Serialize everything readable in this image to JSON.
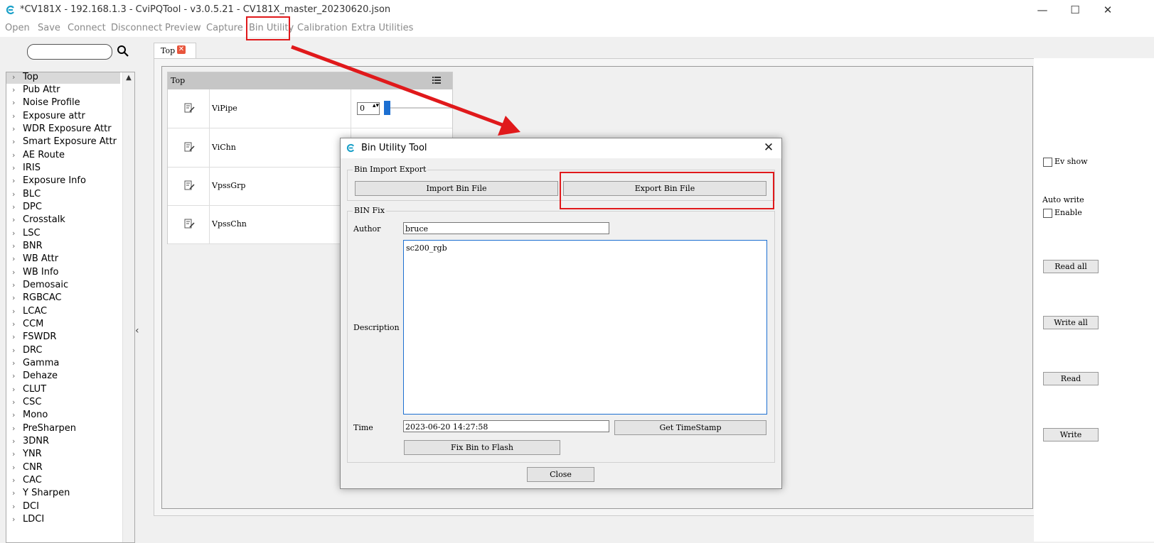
{
  "window": {
    "title": "*CV181X - 192.168.1.3 - CviPQTool - v3.0.5.21 - CV181X_master_20230620.json",
    "minimize": "—",
    "maximize": "☐",
    "close": "✕"
  },
  "menu": {
    "items": [
      "Open",
      "Save",
      "Connect",
      "Disconnect",
      "Preview",
      "Capture",
      "Bin Utility",
      "Calibration",
      "Extra Utilities"
    ]
  },
  "sidebar": {
    "search_value": "",
    "collapse": "‹",
    "scroll_up": "▲",
    "items": [
      "Top",
      "Pub Attr",
      "Noise Profile",
      "Exposure attr",
      "WDR Exposure Attr",
      "Smart Exposure Attr",
      "AE Route",
      "IRIS",
      "Exposure Info",
      "BLC",
      "DPC",
      "Crosstalk",
      "LSC",
      "BNR",
      "WB Attr",
      "WB Info",
      "Demosaic",
      "RGBCAC",
      "LCAC",
      "CCM",
      "FSWDR",
      "DRC",
      "Gamma",
      "Dehaze",
      "CLUT",
      "CSC",
      "Mono",
      "PreSharpen",
      "3DNR",
      "YNR",
      "CNR",
      "CAC",
      "Y Sharpen",
      "DCI",
      "LDCI"
    ],
    "chevron": "›"
  },
  "tab": {
    "label": "Top",
    "close": "✕"
  },
  "param_table": {
    "header": "Top",
    "rows": [
      "ViPipe",
      "ViChn",
      "VpssGrp",
      "VpssChn"
    ],
    "vipipe_value": "0",
    "spin_arrows": "▴▾"
  },
  "right_panel": {
    "ev_show": "Ev show",
    "auto_write": "Auto write",
    "enable": "Enable",
    "read_all": "Read all",
    "write_all": "Write all",
    "read": "Read",
    "write": "Write"
  },
  "dialog": {
    "title": "Bin Utility Tool",
    "close": "✕",
    "group_import_export": "Bin Import Export",
    "import_btn": "Import Bin File",
    "export_btn": "Export Bin File",
    "group_fix": "BIN Fix",
    "author_label": "Author",
    "author_value": "bruce",
    "description_label": "Description",
    "description_value": "sc200_rgb",
    "time_label": "Time",
    "time_value": "2023-06-20 14:27:58",
    "get_timestamp_btn": "Get TimeStamp",
    "fix_btn": "Fix Bin to Flash",
    "close_btn": "Close"
  },
  "colors": {
    "annotation_red": "#e0191b",
    "accent_blue": "#1c6fd1"
  }
}
